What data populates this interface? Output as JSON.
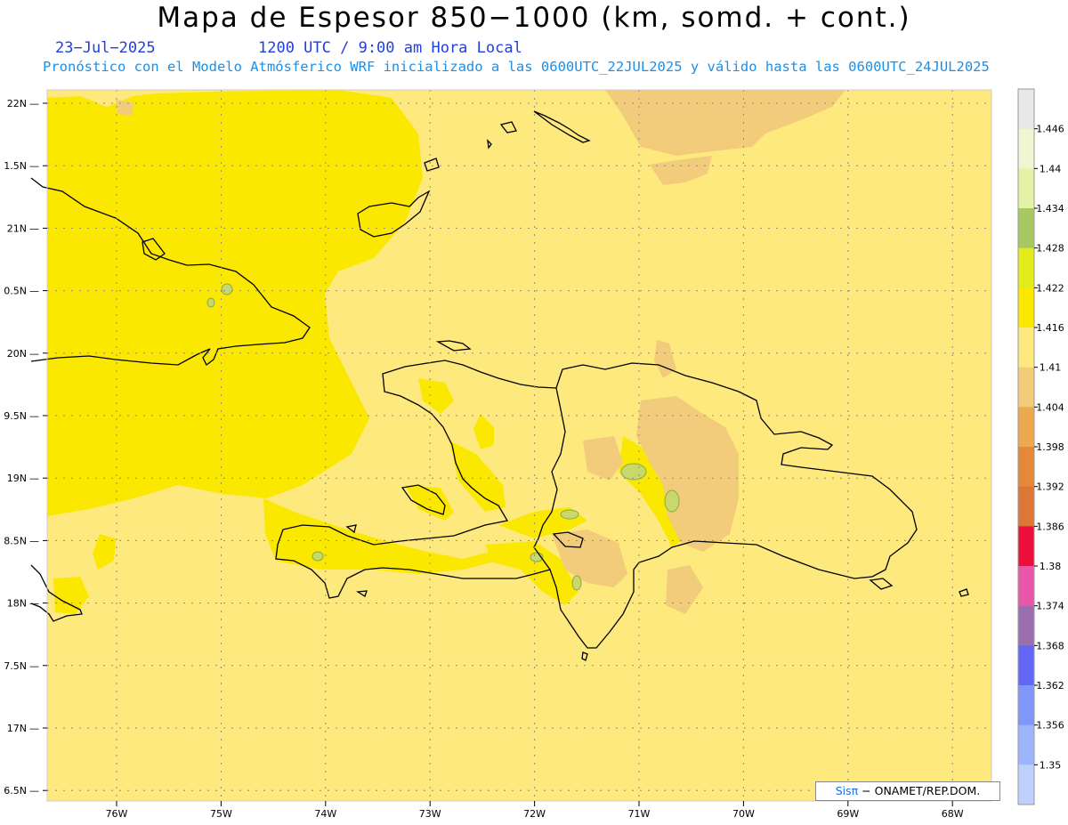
{
  "header": {
    "title": "Mapa de Espesor 850−1000 (km, somd. + cont.)",
    "date": "23−Jul−2025",
    "utc": "1200 UTC / 9:00 am Hora Local",
    "subtitle": "Pronóstico con el Modelo Atmósferico WRF inicializado a las 0600UTC_22JUL2025 y válido hasta las  0600UTC_24JUL2025"
  },
  "axes": {
    "lat_labels": [
      "22N",
      "1.5N",
      "21N",
      "0.5N",
      "20N",
      "9.5N",
      "19N",
      "8.5N",
      "18N",
      "7.5N",
      "17N",
      "6.5N"
    ],
    "lon_labels": [
      "76W",
      "75W",
      "74W",
      "73W",
      "72W",
      "71W",
      "70W",
      "69W",
      "68W"
    ]
  },
  "colorbar": {
    "labels": [
      "1.446",
      "1.44",
      "1.434",
      "1.428",
      "1.422",
      "1.416",
      "1.41",
      "1.404",
      "1.398",
      "1.392",
      "1.386",
      "1.38",
      "1.374",
      "1.368",
      "1.362",
      "1.356",
      "1.35"
    ],
    "colors": [
      "#e8e8e8",
      "#f0f5d2",
      "#e4f2a8",
      "#a9c862",
      "#e2ec1a",
      "#fbe800",
      "#fde97e",
      "#f2cc7a",
      "#eda94e",
      "#e4883a",
      "#dc7738",
      "#ec0f3c",
      "#e957a8",
      "#9970ad",
      "#6467f5",
      "#7f96fb",
      "#9db5fc",
      "#bfcffc"
    ]
  },
  "map_colors": {
    "background": "#fde97e",
    "moist_yellow": "#fbe800",
    "tan": "#f2cc7a",
    "green": "#c8d86a",
    "coast": "#000000"
  },
  "credit": {
    "brand": "Sisπ",
    "text": "− ONAMET/REP.DOM."
  }
}
